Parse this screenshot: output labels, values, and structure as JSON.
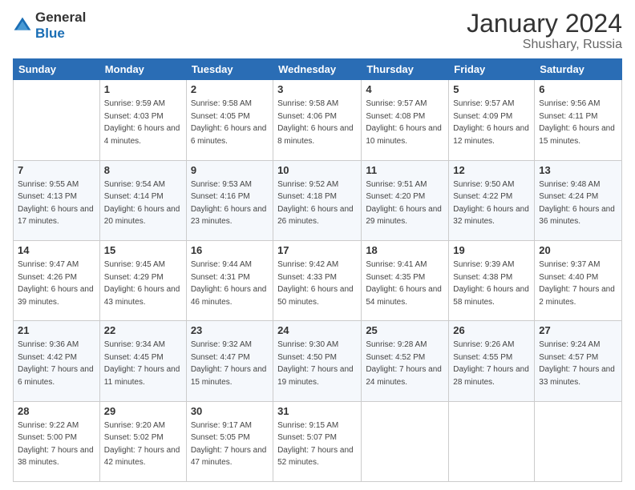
{
  "logo": {
    "general": "General",
    "blue": "Blue"
  },
  "header": {
    "title": "January 2024",
    "subtitle": "Shushary, Russia"
  },
  "columns": [
    "Sunday",
    "Monday",
    "Tuesday",
    "Wednesday",
    "Thursday",
    "Friday",
    "Saturday"
  ],
  "weeks": [
    [
      {
        "day": "",
        "sunrise": "",
        "sunset": "",
        "daylight": ""
      },
      {
        "day": "1",
        "sunrise": "Sunrise: 9:59 AM",
        "sunset": "Sunset: 4:03 PM",
        "daylight": "Daylight: 6 hours and 4 minutes."
      },
      {
        "day": "2",
        "sunrise": "Sunrise: 9:58 AM",
        "sunset": "Sunset: 4:05 PM",
        "daylight": "Daylight: 6 hours and 6 minutes."
      },
      {
        "day": "3",
        "sunrise": "Sunrise: 9:58 AM",
        "sunset": "Sunset: 4:06 PM",
        "daylight": "Daylight: 6 hours and 8 minutes."
      },
      {
        "day": "4",
        "sunrise": "Sunrise: 9:57 AM",
        "sunset": "Sunset: 4:08 PM",
        "daylight": "Daylight: 6 hours and 10 minutes."
      },
      {
        "day": "5",
        "sunrise": "Sunrise: 9:57 AM",
        "sunset": "Sunset: 4:09 PM",
        "daylight": "Daylight: 6 hours and 12 minutes."
      },
      {
        "day": "6",
        "sunrise": "Sunrise: 9:56 AM",
        "sunset": "Sunset: 4:11 PM",
        "daylight": "Daylight: 6 hours and 15 minutes."
      }
    ],
    [
      {
        "day": "7",
        "sunrise": "Sunrise: 9:55 AM",
        "sunset": "Sunset: 4:13 PM",
        "daylight": "Daylight: 6 hours and 17 minutes."
      },
      {
        "day": "8",
        "sunrise": "Sunrise: 9:54 AM",
        "sunset": "Sunset: 4:14 PM",
        "daylight": "Daylight: 6 hours and 20 minutes."
      },
      {
        "day": "9",
        "sunrise": "Sunrise: 9:53 AM",
        "sunset": "Sunset: 4:16 PM",
        "daylight": "Daylight: 6 hours and 23 minutes."
      },
      {
        "day": "10",
        "sunrise": "Sunrise: 9:52 AM",
        "sunset": "Sunset: 4:18 PM",
        "daylight": "Daylight: 6 hours and 26 minutes."
      },
      {
        "day": "11",
        "sunrise": "Sunrise: 9:51 AM",
        "sunset": "Sunset: 4:20 PM",
        "daylight": "Daylight: 6 hours and 29 minutes."
      },
      {
        "day": "12",
        "sunrise": "Sunrise: 9:50 AM",
        "sunset": "Sunset: 4:22 PM",
        "daylight": "Daylight: 6 hours and 32 minutes."
      },
      {
        "day": "13",
        "sunrise": "Sunrise: 9:48 AM",
        "sunset": "Sunset: 4:24 PM",
        "daylight": "Daylight: 6 hours and 36 minutes."
      }
    ],
    [
      {
        "day": "14",
        "sunrise": "Sunrise: 9:47 AM",
        "sunset": "Sunset: 4:26 PM",
        "daylight": "Daylight: 6 hours and 39 minutes."
      },
      {
        "day": "15",
        "sunrise": "Sunrise: 9:45 AM",
        "sunset": "Sunset: 4:29 PM",
        "daylight": "Daylight: 6 hours and 43 minutes."
      },
      {
        "day": "16",
        "sunrise": "Sunrise: 9:44 AM",
        "sunset": "Sunset: 4:31 PM",
        "daylight": "Daylight: 6 hours and 46 minutes."
      },
      {
        "day": "17",
        "sunrise": "Sunrise: 9:42 AM",
        "sunset": "Sunset: 4:33 PM",
        "daylight": "Daylight: 6 hours and 50 minutes."
      },
      {
        "day": "18",
        "sunrise": "Sunrise: 9:41 AM",
        "sunset": "Sunset: 4:35 PM",
        "daylight": "Daylight: 6 hours and 54 minutes."
      },
      {
        "day": "19",
        "sunrise": "Sunrise: 9:39 AM",
        "sunset": "Sunset: 4:38 PM",
        "daylight": "Daylight: 6 hours and 58 minutes."
      },
      {
        "day": "20",
        "sunrise": "Sunrise: 9:37 AM",
        "sunset": "Sunset: 4:40 PM",
        "daylight": "Daylight: 7 hours and 2 minutes."
      }
    ],
    [
      {
        "day": "21",
        "sunrise": "Sunrise: 9:36 AM",
        "sunset": "Sunset: 4:42 PM",
        "daylight": "Daylight: 7 hours and 6 minutes."
      },
      {
        "day": "22",
        "sunrise": "Sunrise: 9:34 AM",
        "sunset": "Sunset: 4:45 PM",
        "daylight": "Daylight: 7 hours and 11 minutes."
      },
      {
        "day": "23",
        "sunrise": "Sunrise: 9:32 AM",
        "sunset": "Sunset: 4:47 PM",
        "daylight": "Daylight: 7 hours and 15 minutes."
      },
      {
        "day": "24",
        "sunrise": "Sunrise: 9:30 AM",
        "sunset": "Sunset: 4:50 PM",
        "daylight": "Daylight: 7 hours and 19 minutes."
      },
      {
        "day": "25",
        "sunrise": "Sunrise: 9:28 AM",
        "sunset": "Sunset: 4:52 PM",
        "daylight": "Daylight: 7 hours and 24 minutes."
      },
      {
        "day": "26",
        "sunrise": "Sunrise: 9:26 AM",
        "sunset": "Sunset: 4:55 PM",
        "daylight": "Daylight: 7 hours and 28 minutes."
      },
      {
        "day": "27",
        "sunrise": "Sunrise: 9:24 AM",
        "sunset": "Sunset: 4:57 PM",
        "daylight": "Daylight: 7 hours and 33 minutes."
      }
    ],
    [
      {
        "day": "28",
        "sunrise": "Sunrise: 9:22 AM",
        "sunset": "Sunset: 5:00 PM",
        "daylight": "Daylight: 7 hours and 38 minutes."
      },
      {
        "day": "29",
        "sunrise": "Sunrise: 9:20 AM",
        "sunset": "Sunset: 5:02 PM",
        "daylight": "Daylight: 7 hours and 42 minutes."
      },
      {
        "day": "30",
        "sunrise": "Sunrise: 9:17 AM",
        "sunset": "Sunset: 5:05 PM",
        "daylight": "Daylight: 7 hours and 47 minutes."
      },
      {
        "day": "31",
        "sunrise": "Sunrise: 9:15 AM",
        "sunset": "Sunset: 5:07 PM",
        "daylight": "Daylight: 7 hours and 52 minutes."
      },
      {
        "day": "",
        "sunrise": "",
        "sunset": "",
        "daylight": ""
      },
      {
        "day": "",
        "sunrise": "",
        "sunset": "",
        "daylight": ""
      },
      {
        "day": "",
        "sunrise": "",
        "sunset": "",
        "daylight": ""
      }
    ]
  ]
}
